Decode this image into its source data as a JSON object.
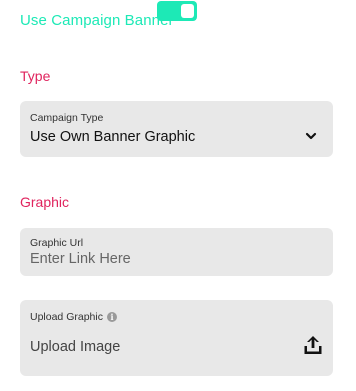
{
  "toggle": {
    "label": "Use Campaign Banner",
    "state": "on",
    "color": "#1de9b6"
  },
  "sections": {
    "type_heading": "Type",
    "graphic_heading": "Graphic",
    "heading_color": "#e0245e"
  },
  "campaign_type": {
    "label": "Campaign Type",
    "selected": "Use Own Banner Graphic",
    "icon": "chevron-down-icon"
  },
  "graphic_url": {
    "label": "Graphic Url",
    "placeholder": "Enter Link Here",
    "value": ""
  },
  "upload_graphic": {
    "label": "Upload Graphic",
    "info_icon": "info-icon",
    "prompt": "Upload Image",
    "icon": "upload-icon"
  }
}
